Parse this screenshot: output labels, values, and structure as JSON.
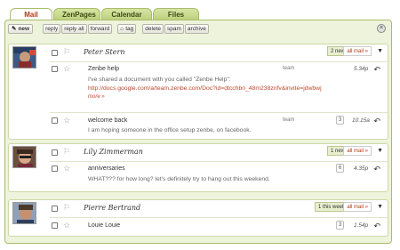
{
  "tabs": [
    {
      "label": "Mail",
      "active": true
    },
    {
      "label": "ZenPages",
      "active": false
    },
    {
      "label": "Calendar",
      "active": false
    },
    {
      "label": "Files",
      "active": false
    }
  ],
  "toolbar": {
    "new_label": "new",
    "buttons": [
      "reply",
      "reply all",
      "forward"
    ],
    "tag_label": "tag",
    "actions": [
      "delete",
      "spam",
      "archive"
    ]
  },
  "threads": [
    {
      "sender": "Peter Stern",
      "badge": "2 new",
      "all_mail": "all mail »",
      "messages": [
        {
          "title": "Zenbe help",
          "tag": "team",
          "time": "5.34p",
          "preview": "I've shared a document with you called \"Zenbe Help\":",
          "link": "http://docs.google.com/a/team.zenbe.com/Doc?id=dtcchbn_48m238znfv&invite=jdwbwj",
          "more": "more »"
        },
        {
          "title": "welcome back",
          "tag": "team",
          "count": "3",
          "time": "10.15a",
          "preview": "I am hoping someone in the office setup zenbe, on facebook."
        }
      ]
    },
    {
      "sender": "Lily Zimmerman",
      "badge": "1 new",
      "all_mail": "all mail »",
      "messages": [
        {
          "title": "anniversaries",
          "count": "6",
          "time": "4.35p",
          "preview": "WHAT??? for how long? let's definitely try to hang out this weekend."
        }
      ]
    },
    {
      "sender": "Pierre Bertrand",
      "badge": "1 this week",
      "all_mail": "all mail »",
      "messages": [
        {
          "title": "Louie Louie",
          "count": "3",
          "time": "1.54p"
        }
      ]
    }
  ],
  "colors": {
    "tab_bg": "#c9da8a",
    "active_tab_text": "#b03a12",
    "panel_bg": "#eef3db",
    "link": "#b8462a"
  },
  "icons": {
    "new": "pencil-icon",
    "tag": "tag-icon",
    "close": "close-circle-icon",
    "thread_menu": "chevron-down-icon",
    "reply": "reply-arrow-icon",
    "star": "star-icon",
    "flag": "flag-icon"
  }
}
